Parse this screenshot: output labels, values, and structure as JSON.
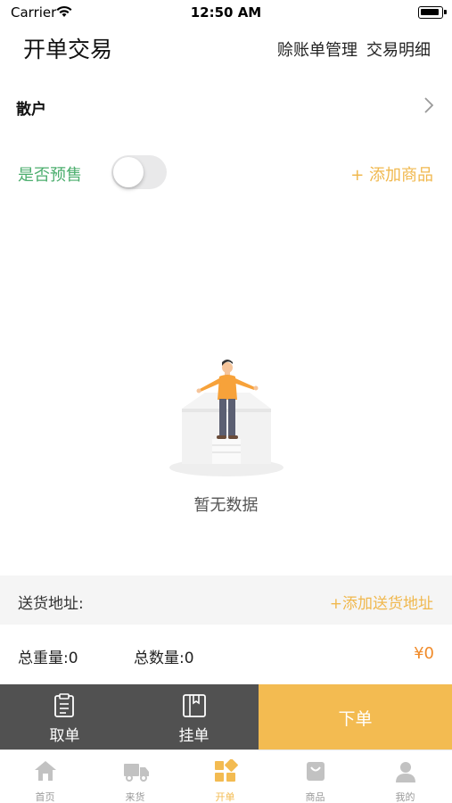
{
  "status_bar": {
    "carrier": "Carrier",
    "time": "12:50 AM"
  },
  "header": {
    "title": "开单交易",
    "links": [
      "赊账单管理",
      "交易明细"
    ]
  },
  "customer": {
    "label": "散户"
  },
  "presale": {
    "label": "是否预售",
    "enabled": false,
    "add_label": "+ 添加商品"
  },
  "empty_state": {
    "text": "暂无数据"
  },
  "address": {
    "label": "送货地址:",
    "add_label": "+添加送货地址"
  },
  "totals": {
    "weight_label": "总重量:0",
    "quantity_label": "总数量:0",
    "price": "¥0"
  },
  "actions": {
    "take_order": "取单",
    "hold_order": "挂单",
    "place_order": "下单"
  },
  "tabbar": {
    "active_index": 2,
    "tabs": [
      {
        "label": "首页",
        "icon": "home-icon"
      },
      {
        "label": "来货",
        "icon": "truck-icon"
      },
      {
        "label": "开单",
        "icon": "grid-icon"
      },
      {
        "label": "商品",
        "icon": "bag-icon"
      },
      {
        "label": "我的",
        "icon": "user-icon"
      }
    ]
  },
  "colors": {
    "accent": "#f3bb51",
    "green": "#4cae6e",
    "price": "#f08b2a",
    "dark": "#515151"
  }
}
